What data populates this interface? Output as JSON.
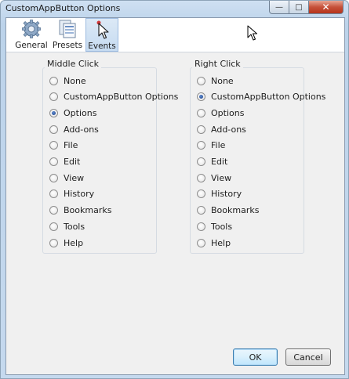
{
  "window": {
    "title": "CustomAppButton Options"
  },
  "toolbar": {
    "items": [
      {
        "label": "General",
        "icon": "gear-icon"
      },
      {
        "label": "Presets",
        "icon": "presets-icon"
      },
      {
        "label": "Events",
        "icon": "pointer-events-icon",
        "active": true
      }
    ]
  },
  "middle_click": {
    "label": "Middle Click",
    "options": [
      "None",
      "CustomAppButton Options",
      "Options",
      "Add-ons",
      "File",
      "Edit",
      "View",
      "History",
      "Bookmarks",
      "Tools",
      "Help"
    ],
    "selected": "Options"
  },
  "right_click": {
    "label": "Right Click",
    "options": [
      "None",
      "CustomAppButton Options",
      "Options",
      "Add-ons",
      "File",
      "Edit",
      "View",
      "History",
      "Bookmarks",
      "Tools",
      "Help"
    ],
    "selected": "CustomAppButton Options"
  },
  "buttons": {
    "ok": "OK",
    "cancel": "Cancel"
  },
  "colors": {
    "titlebar": "#c5d9ee",
    "active_tab": "#c6dbf1",
    "dialog_bg": "#f0f0f0"
  }
}
